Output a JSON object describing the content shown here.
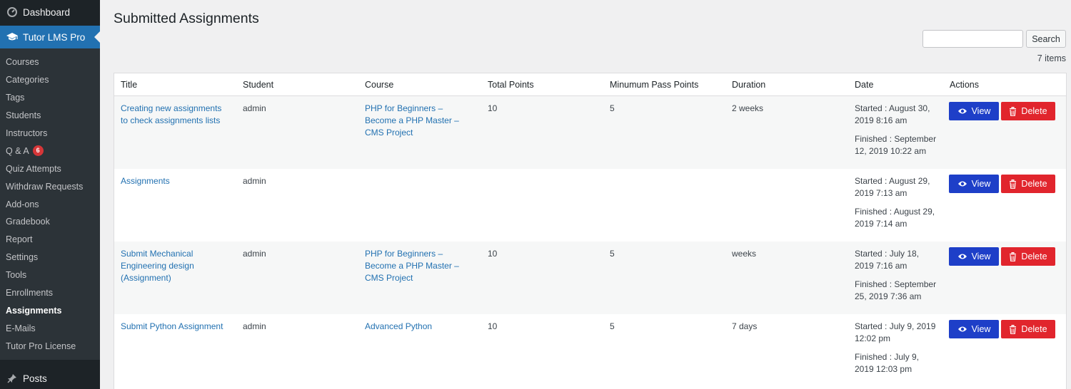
{
  "sidebar": {
    "dashboard": "Dashboard",
    "tutor": "Tutor LMS Pro",
    "items": [
      {
        "label": "Courses"
      },
      {
        "label": "Categories"
      },
      {
        "label": "Tags"
      },
      {
        "label": "Students"
      },
      {
        "label": "Instructors"
      },
      {
        "label": "Q & A",
        "badge": "6"
      },
      {
        "label": "Quiz Attempts"
      },
      {
        "label": "Withdraw Requests"
      },
      {
        "label": "Add-ons"
      },
      {
        "label": "Gradebook"
      },
      {
        "label": "Report"
      },
      {
        "label": "Settings"
      },
      {
        "label": "Tools"
      },
      {
        "label": "Enrollments"
      },
      {
        "label": "Assignments",
        "current": true
      },
      {
        "label": "E-Mails"
      },
      {
        "label": "Tutor Pro License"
      }
    ],
    "posts": "Posts"
  },
  "page": {
    "title": "Submitted Assignments",
    "search_button": "Search",
    "items_count": "7 items"
  },
  "table": {
    "headers": {
      "title": "Title",
      "student": "Student",
      "course": "Course",
      "total_points": "Total Points",
      "pass_points": "Minumum Pass Points",
      "duration": "Duration",
      "date": "Date",
      "actions": "Actions"
    },
    "view_label": "View",
    "delete_label": "Delete",
    "rows": [
      {
        "title": "Creating new assignments to check assignments lists",
        "student": "admin",
        "course": "PHP for Beginners – Become a PHP Master – CMS Project",
        "total_points": "10",
        "pass_points": "5",
        "duration": "2 weeks",
        "started": "Started : August 30, 2019 8:16 am",
        "finished": "Finished : September 12, 2019 10:22 am"
      },
      {
        "title": "Assignments",
        "student": "admin",
        "course": "",
        "total_points": "",
        "pass_points": "",
        "duration": "",
        "started": "Started : August 29, 2019 7:13 am",
        "finished": "Finished : August 29, 2019 7:14 am"
      },
      {
        "title": "Submit Mechanical Engineering design (Assignment)",
        "student": "admin",
        "course": "PHP for Beginners – Become a PHP Master – CMS Project",
        "total_points": "10",
        "pass_points": "5",
        "duration": "weeks",
        "started": "Started : July 18, 2019 7:16 am",
        "finished": "Finished : September 25, 2019 7:36 am"
      },
      {
        "title": "Submit Python Assignment",
        "student": "admin",
        "course": "Advanced Python",
        "total_points": "10",
        "pass_points": "5",
        "duration": "7 days",
        "started": "Started : July 9, 2019 12:02 pm",
        "finished": "Finished : July 9, 2019 12:03 pm"
      }
    ]
  },
  "colors": {
    "sidebar_bg": "#1d2327",
    "accent": "#2271b1",
    "view_button": "#1e3fc8",
    "delete_button": "#e1252d"
  }
}
